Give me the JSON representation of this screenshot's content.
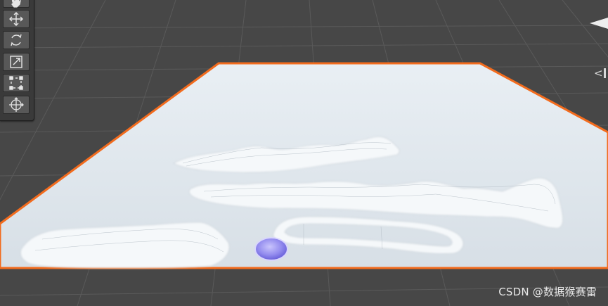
{
  "scene_view": {
    "tools": [
      {
        "name": "hand-tool",
        "icon": "hand-icon"
      },
      {
        "name": "move-tool",
        "icon": "move-arrows-icon"
      },
      {
        "name": "rotate-tool",
        "icon": "rotate-icon"
      },
      {
        "name": "scale-tool",
        "icon": "scale-icon"
      },
      {
        "name": "rect-tool",
        "icon": "rect-transform-icon"
      },
      {
        "name": "transform-tool",
        "icon": "transform-icon"
      }
    ],
    "selection_outline_color": "#f26b1d",
    "terrain_color": "#e4ebf0",
    "background_color": "#474747",
    "gizmo_label": "<"
  },
  "watermark": {
    "text": "CSDN @数据猴赛雷"
  }
}
